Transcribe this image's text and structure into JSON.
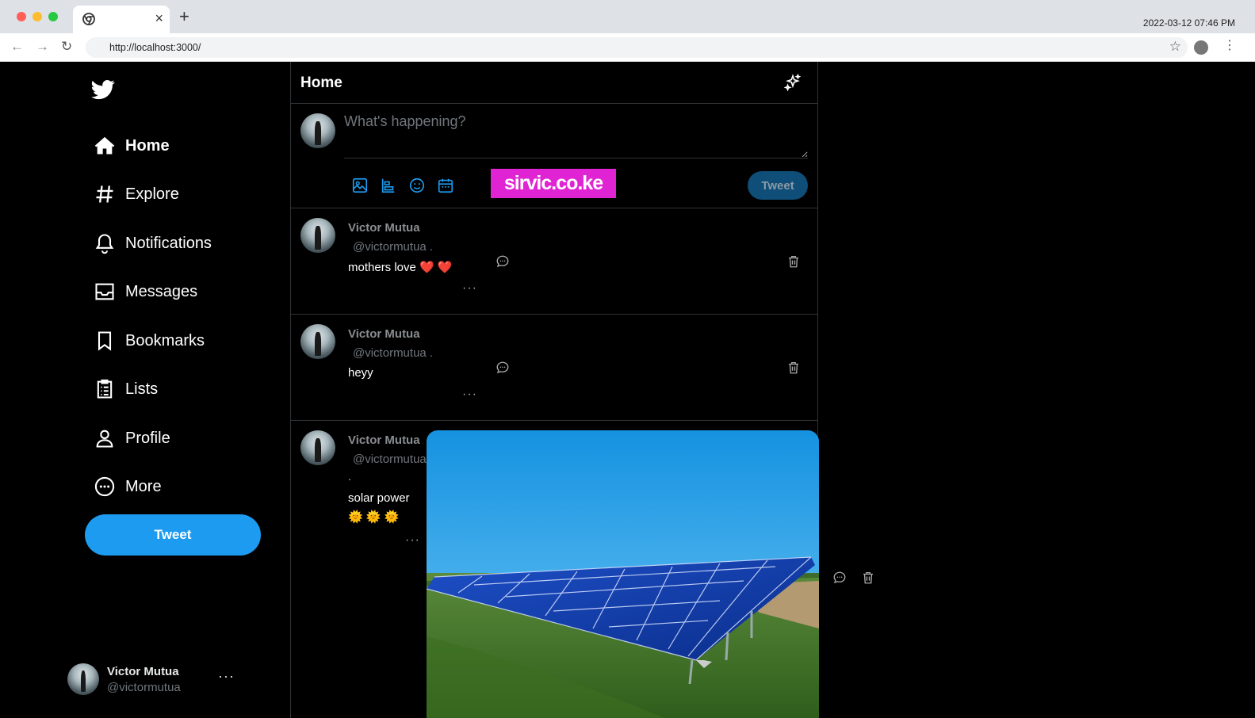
{
  "browser": {
    "tab_close": "×",
    "new_tab": "+",
    "datetime": "2022-03-12 07:46 PM",
    "url": "http://localhost:3000/",
    "back": "←",
    "forward": "→",
    "reload": "↻",
    "bookmark_star": "☆",
    "menu": "⋮"
  },
  "sidebar": {
    "nav": [
      {
        "label": "Home",
        "icon": "home-icon",
        "active": true
      },
      {
        "label": "Explore",
        "icon": "hashtag-icon"
      },
      {
        "label": "Notifications",
        "icon": "bell-icon"
      },
      {
        "label": "Messages",
        "icon": "envelope-icon"
      },
      {
        "label": "Bookmarks",
        "icon": "bookmark-icon"
      },
      {
        "label": "Lists",
        "icon": "list-icon"
      },
      {
        "label": "Profile",
        "icon": "user-icon"
      },
      {
        "label": "More",
        "icon": "more-circle-icon"
      }
    ],
    "tweet_button": "Tweet",
    "account": {
      "name": "Victor Mutua",
      "handle": "@victormutua",
      "more": "···"
    }
  },
  "main": {
    "title": "Home",
    "composer": {
      "placeholder": "What's happening?",
      "tweet_button": "Tweet",
      "watermark": "sirvic.co.ke"
    },
    "tweets": [
      {
        "name": "Victor Mutua",
        "handle": "@victormutua .",
        "text": "mothers love ❤️ ❤️",
        "more": "···"
      },
      {
        "name": "Victor Mutua",
        "handle": "@victormutua .",
        "text": "heyy",
        "more": "···"
      },
      {
        "name": "Victor Mutua",
        "handle": "@victormutua",
        "dot": ".",
        "text": "solar power",
        "emoji": "🌞 🌞 🌞",
        "more": "···",
        "has_image": true
      }
    ]
  },
  "colors": {
    "accent": "#1d9bf0",
    "background": "#000000",
    "border": "#2f3336",
    "watermark": "#e024d4"
  }
}
